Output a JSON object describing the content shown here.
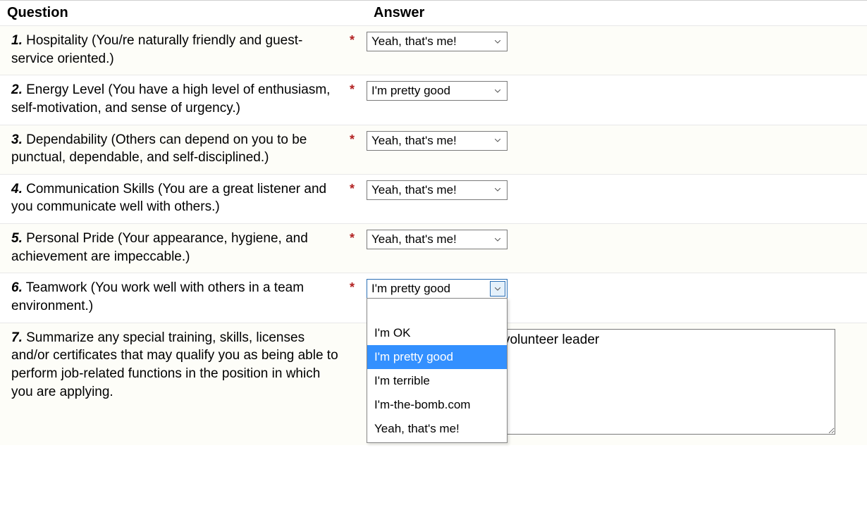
{
  "headers": {
    "question": "Question",
    "answer": "Answer"
  },
  "required_mark": "*",
  "questions": [
    {
      "num": "1.",
      "text": " Hospitality (You/re naturally friendly and guest-service oriented.)",
      "selected": "Yeah, that's me!"
    },
    {
      "num": "2.",
      "text": " Energy Level (You have a high level of enthusiasm, self-motivation, and sense of urgency.)",
      "selected": "I'm pretty good"
    },
    {
      "num": "3.",
      "text": " Dependability (Others can depend on you to be punctual, dependable, and self-disciplined.)",
      "selected": "Yeah, that's me!"
    },
    {
      "num": "4.",
      "text": " Communication Skills (You are a great listener and you communicate well with others.)",
      "selected": "Yeah, that's me!"
    },
    {
      "num": "5.",
      "text": " Personal Pride (Your appearance, hygiene, and achievement are impeccable.)",
      "selected": "Yeah, that's me!"
    },
    {
      "num": "6.",
      "text": " Teamwork (You work well with others in a team environment.)",
      "selected": "I'm pretty good",
      "open": true
    },
    {
      "num": "7.",
      "text": " Summarize any special training, skills, licenses and/or certificates that may qualify you as being able to perform job-related functions in the position in which you are applying.",
      "textarea_partial": "ice as adult Venturing volunteer leader"
    }
  ],
  "options": [
    "",
    "I'm OK",
    "I'm pretty good",
    "I'm terrible",
    "I'm-the-bomb.com",
    "Yeah, that's me!"
  ],
  "highlighted_option": "I'm pretty good"
}
